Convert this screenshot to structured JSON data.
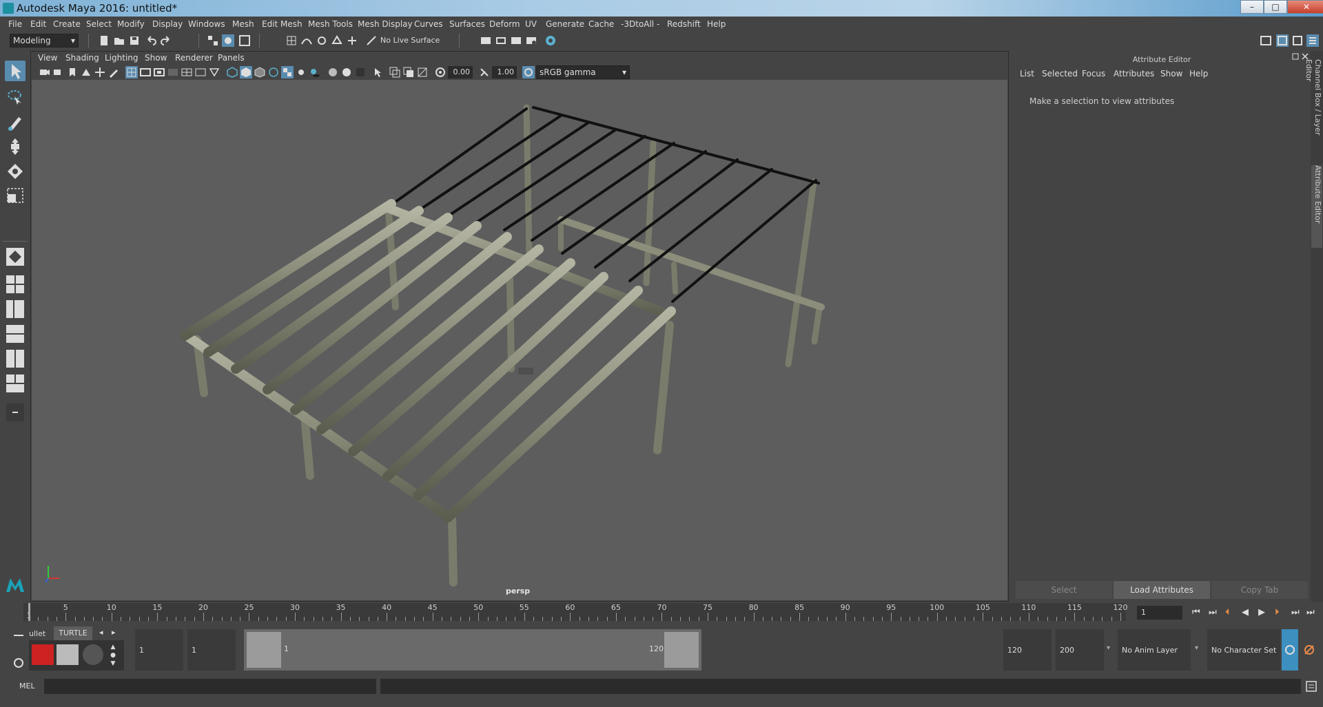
{
  "window": {
    "title": "Autodesk Maya 2016: untitled*",
    "minimize": "–",
    "maximize": "□",
    "close": "✕"
  },
  "menus": [
    "File",
    "Edit",
    "Create",
    "Select",
    "Modify",
    "Display",
    "Windows",
    "Mesh",
    "Edit Mesh",
    "Mesh Tools",
    "Mesh Display",
    "Curves",
    "Surfaces",
    "Deform",
    "UV",
    "Generate",
    "Cache",
    "-3DtoAll -",
    "Redshift",
    "Help"
  ],
  "statusline": {
    "menuset": "Modeling",
    "live_surface": "No Live Surface"
  },
  "panel_menus": [
    "View",
    "Shading",
    "Lighting",
    "Show",
    "Renderer",
    "Panels"
  ],
  "panel_toolbar": {
    "exposure": "0.00",
    "gamma": "1.00",
    "color_space": "sRGB gamma"
  },
  "viewport": {
    "camera_label": "persp"
  },
  "attribute_editor": {
    "header": "Attribute Editor",
    "menus": [
      "List",
      "Selected",
      "Focus",
      "Attributes",
      "Show",
      "Help"
    ],
    "message": "Make a selection to view attributes",
    "buttons": {
      "select": "Select",
      "load": "Load Attributes",
      "copy": "Copy Tab"
    }
  },
  "side_tabs": {
    "channel_box": "Channel Box / Layer Editor",
    "attribute_editor": "Attribute Editor"
  },
  "timeslider": {
    "labels": [
      "1",
      "5",
      "10",
      "15",
      "20",
      "25",
      "30",
      "35",
      "40",
      "45",
      "50",
      "55",
      "60",
      "65",
      "70",
      "75",
      "80",
      "85",
      "90",
      "95",
      "100",
      "105",
      "110",
      "115",
      "120"
    ],
    "current_frame": "1"
  },
  "range": {
    "start_field": "1",
    "start_field2": "1",
    "range_start": "1",
    "range_end": "120",
    "end_field": "120",
    "end_field2": "200",
    "anim_layer": "No Anim Layer",
    "character_set": "No Character Set"
  },
  "shelf": {
    "tab_partial": "ullet",
    "tab_active": "TURTLE"
  },
  "mel": {
    "label": "MEL"
  },
  "colors": {
    "viewport_bg": "#5d5d5d",
    "ui_bg": "#444444",
    "active_tool": "#5a8cb0",
    "wood": "#8c8e7b"
  }
}
